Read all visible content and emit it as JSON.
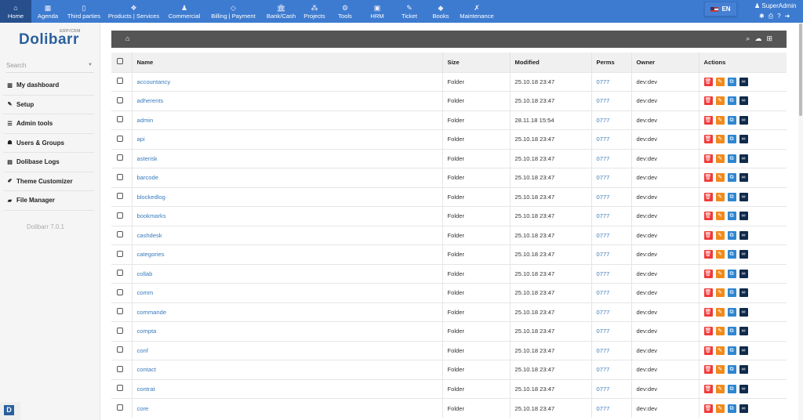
{
  "topnav": {
    "items": [
      {
        "label": "Home",
        "icon": "home-icon",
        "glyph": "⌂"
      },
      {
        "label": "Agenda",
        "icon": "calendar-icon",
        "glyph": "▦"
      },
      {
        "label": "Third parties",
        "icon": "building-icon",
        "glyph": "▯"
      },
      {
        "label": "Products | Services",
        "icon": "cubes-icon",
        "glyph": "❖"
      },
      {
        "label": "Commercial",
        "icon": "user-tie-icon",
        "glyph": "♟"
      },
      {
        "label": "Billing | Payment",
        "icon": "diamond-icon",
        "glyph": "◇"
      },
      {
        "label": "Bank/Cash",
        "icon": "bank-icon",
        "glyph": "🏛"
      },
      {
        "label": "Projects",
        "icon": "sitemap-icon",
        "glyph": "⁂"
      },
      {
        "label": "Tools",
        "icon": "cogs-icon",
        "glyph": "⚙"
      },
      {
        "label": "HRM",
        "icon": "id-card-icon",
        "glyph": "▣"
      },
      {
        "label": "Ticket",
        "icon": "ticket-icon",
        "glyph": "✎"
      },
      {
        "label": "Books",
        "icon": "books-icon",
        "glyph": "◆"
      },
      {
        "label": "Maintenance",
        "icon": "wrench-icon",
        "glyph": "✗"
      }
    ],
    "language": "EN",
    "user": "SuperAdmin"
  },
  "sidebar": {
    "logo": "Dolibarr",
    "logo_sub": "ERP/CRM",
    "search_placeholder": "Search",
    "items": [
      {
        "label": "My dashboard",
        "glyph": "▥"
      },
      {
        "label": "Setup",
        "glyph": "✎"
      },
      {
        "label": "Admin tools",
        "glyph": "☰"
      },
      {
        "label": "Users & Groups",
        "glyph": "☗"
      },
      {
        "label": "Dolibase Logs",
        "glyph": "▤"
      },
      {
        "label": "Theme Customizer",
        "glyph": "✐"
      },
      {
        "label": "File Manager",
        "glyph": "▰"
      }
    ],
    "version": "Dolibarr 7.0.1",
    "badge": "D"
  },
  "table": {
    "headers": [
      "Name",
      "Size",
      "Modified",
      "Perms",
      "Owner",
      "Actions"
    ],
    "rows": [
      [
        "accountancy",
        "Folder",
        "25.10.18 23:47",
        "0777",
        "dev:dev"
      ],
      [
        "adherents",
        "Folder",
        "25.10.18 23:47",
        "0777",
        "dev:dev"
      ],
      [
        "admin",
        "Folder",
        "28.11.18 15:54",
        "0777",
        "dev:dev"
      ],
      [
        "api",
        "Folder",
        "25.10.18 23:47",
        "0777",
        "dev:dev"
      ],
      [
        "asterisk",
        "Folder",
        "25.10.18 23:47",
        "0777",
        "dev:dev"
      ],
      [
        "barcode",
        "Folder",
        "25.10.18 23:47",
        "0777",
        "dev:dev"
      ],
      [
        "blockedlog",
        "Folder",
        "25.10.18 23:47",
        "0777",
        "dev:dev"
      ],
      [
        "bookmarks",
        "Folder",
        "25.10.18 23:47",
        "0777",
        "dev:dev"
      ],
      [
        "cashdesk",
        "Folder",
        "25.10.18 23:47",
        "0777",
        "dev:dev"
      ],
      [
        "categories",
        "Folder",
        "25.10.18 23:47",
        "0777",
        "dev:dev"
      ],
      [
        "collab",
        "Folder",
        "25.10.18 23:47",
        "0777",
        "dev:dev"
      ],
      [
        "comm",
        "Folder",
        "25.10.18 23:47",
        "0777",
        "dev:dev"
      ],
      [
        "commande",
        "Folder",
        "25.10.18 23:47",
        "0777",
        "dev:dev"
      ],
      [
        "compta",
        "Folder",
        "25.10.18 23:47",
        "0777",
        "dev:dev"
      ],
      [
        "conf",
        "Folder",
        "25.10.18 23:47",
        "0777",
        "dev:dev"
      ],
      [
        "contact",
        "Folder",
        "25.10.18 23:47",
        "0777",
        "dev:dev"
      ],
      [
        "contrat",
        "Folder",
        "25.10.18 23:47",
        "0777",
        "dev:dev"
      ],
      [
        "core",
        "Folder",
        "25.10.18 23:47",
        "0777",
        "dev:dev"
      ]
    ],
    "actions": [
      {
        "name": "delete",
        "color": "#f03a3a",
        "glyph": "🗑"
      },
      {
        "name": "rename",
        "color": "#f08a1c",
        "glyph": "✎"
      },
      {
        "name": "copy",
        "color": "#2f86d0",
        "glyph": "⧉"
      },
      {
        "name": "link",
        "color": "#0f2a4a",
        "glyph": "∞"
      }
    ]
  }
}
